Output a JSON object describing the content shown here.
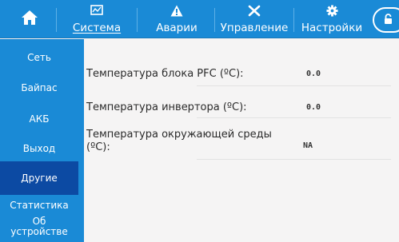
{
  "colors": {
    "accent": "#1a8ad6",
    "active_sidebar": "#0c4aa3",
    "background": "#f5f4f4",
    "text": "#2b2b2b"
  },
  "header": {
    "home_icon": "home-icon",
    "tabs": [
      {
        "label": "Система",
        "icon": "chart-monitor-icon",
        "active": true
      },
      {
        "label": "Аварии",
        "icon": "warning-icon",
        "active": false
      },
      {
        "label": "Управление",
        "icon": "tools-icon",
        "active": false
      },
      {
        "label": "Настройки",
        "icon": "gear-icon",
        "active": false
      }
    ],
    "lock_icon": "lock-icon"
  },
  "sidebar": {
    "items": [
      {
        "label": "Сеть",
        "active": false
      },
      {
        "label": "Байпас",
        "active": false
      },
      {
        "label": "АКБ",
        "active": false
      },
      {
        "label": "Выход",
        "active": false
      },
      {
        "label": "Другие",
        "active": true
      },
      {
        "label": "Статистика",
        "active": false
      },
      {
        "label": "Об устройстве",
        "active": false
      }
    ]
  },
  "main": {
    "rows": [
      {
        "label": "Температура блока PFC (ºC):",
        "value": "0.0"
      },
      {
        "label": "Температура инвертора (ºC):",
        "value": "0.0"
      },
      {
        "label": "Температура окружающей среды (ºC):",
        "value": "NA"
      }
    ]
  }
}
